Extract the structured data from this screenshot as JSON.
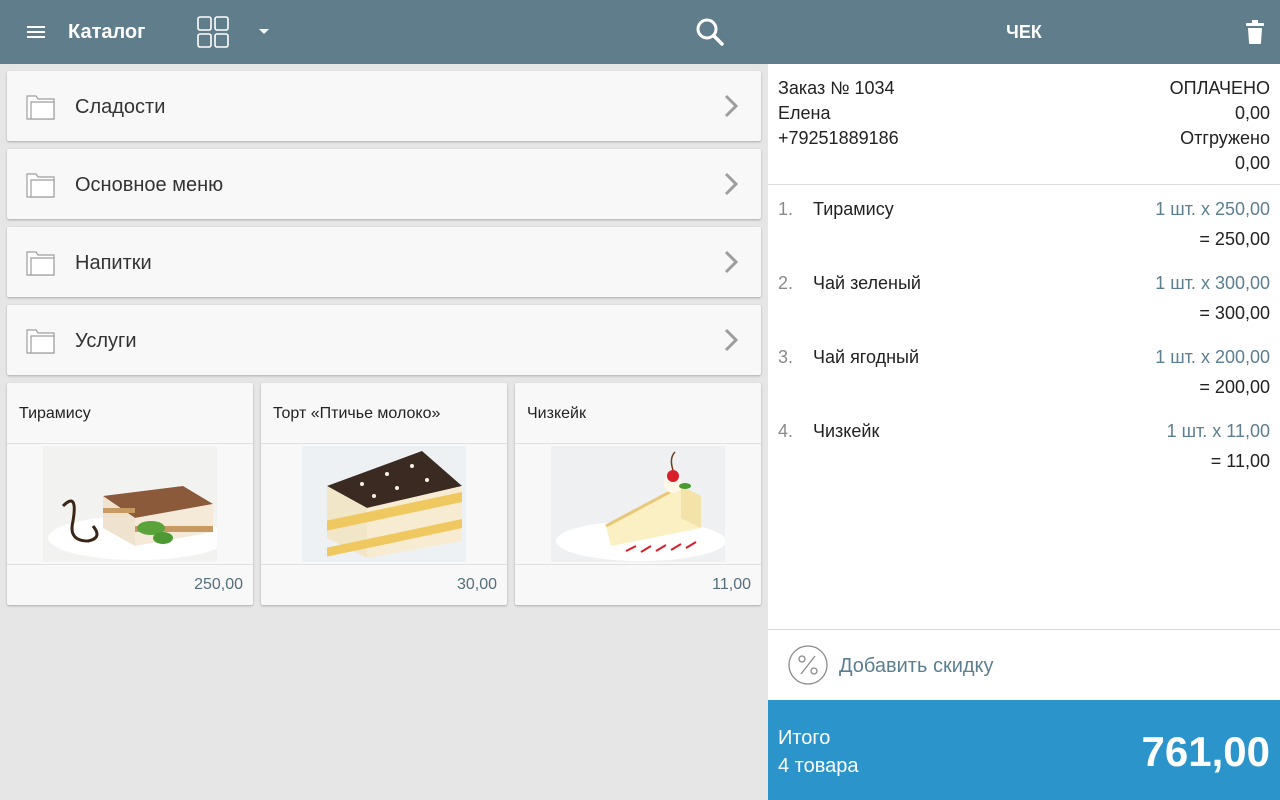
{
  "topbar": {
    "catalog_title": "Каталог",
    "receipt_title": "ЧЕК",
    "menu_icon": "hamburger-icon",
    "view_icon": "grid-view-icon",
    "dropdown_icon": "triangle-down-icon",
    "search_icon": "search-icon",
    "trash_icon": "trash-icon",
    "color": "#607d8b"
  },
  "catalog": {
    "folders": [
      {
        "label": "Сладости"
      },
      {
        "label": "Основное меню"
      },
      {
        "label": "Напитки"
      },
      {
        "label": "Услуги"
      }
    ],
    "products": [
      {
        "name": "Тирамису",
        "price": "250,00",
        "image": "tiramisu-photo"
      },
      {
        "name": "Торт «Птичье молоко»",
        "price": "30,00",
        "image": "bird-milk-cake-photo"
      },
      {
        "name": "Чизкейк",
        "price": "11,00",
        "image": "cheesecake-photo"
      }
    ]
  },
  "receipt": {
    "order_number": "Заказ № 1034",
    "status": "ОПЛАЧЕНО",
    "customer": "Елена",
    "paid_amount": "0,00",
    "phone": "+79251889186",
    "shipped_label": "Отгружено",
    "shipped_amount": "0,00",
    "items": [
      {
        "num": "1.",
        "name": "Тирамису",
        "qty": "1 шт. x 250,00",
        "total": "= 250,00"
      },
      {
        "num": "2.",
        "name": "Чай зеленый",
        "qty": "1 шт. x 300,00",
        "total": "= 300,00"
      },
      {
        "num": "3.",
        "name": "Чай ягодный",
        "qty": "1 шт. x 200,00",
        "total": "= 200,00"
      },
      {
        "num": "4.",
        "name": "Чизкейк",
        "qty": "1 шт. x 11,00",
        "total": "= 11,00"
      }
    ],
    "discount_label": "Добавить скидку",
    "discount_icon": "percent-icon",
    "total_label": "Итого",
    "total_count": "4 товара",
    "total_sum": "761,00",
    "total_color": "#2b95cb"
  }
}
